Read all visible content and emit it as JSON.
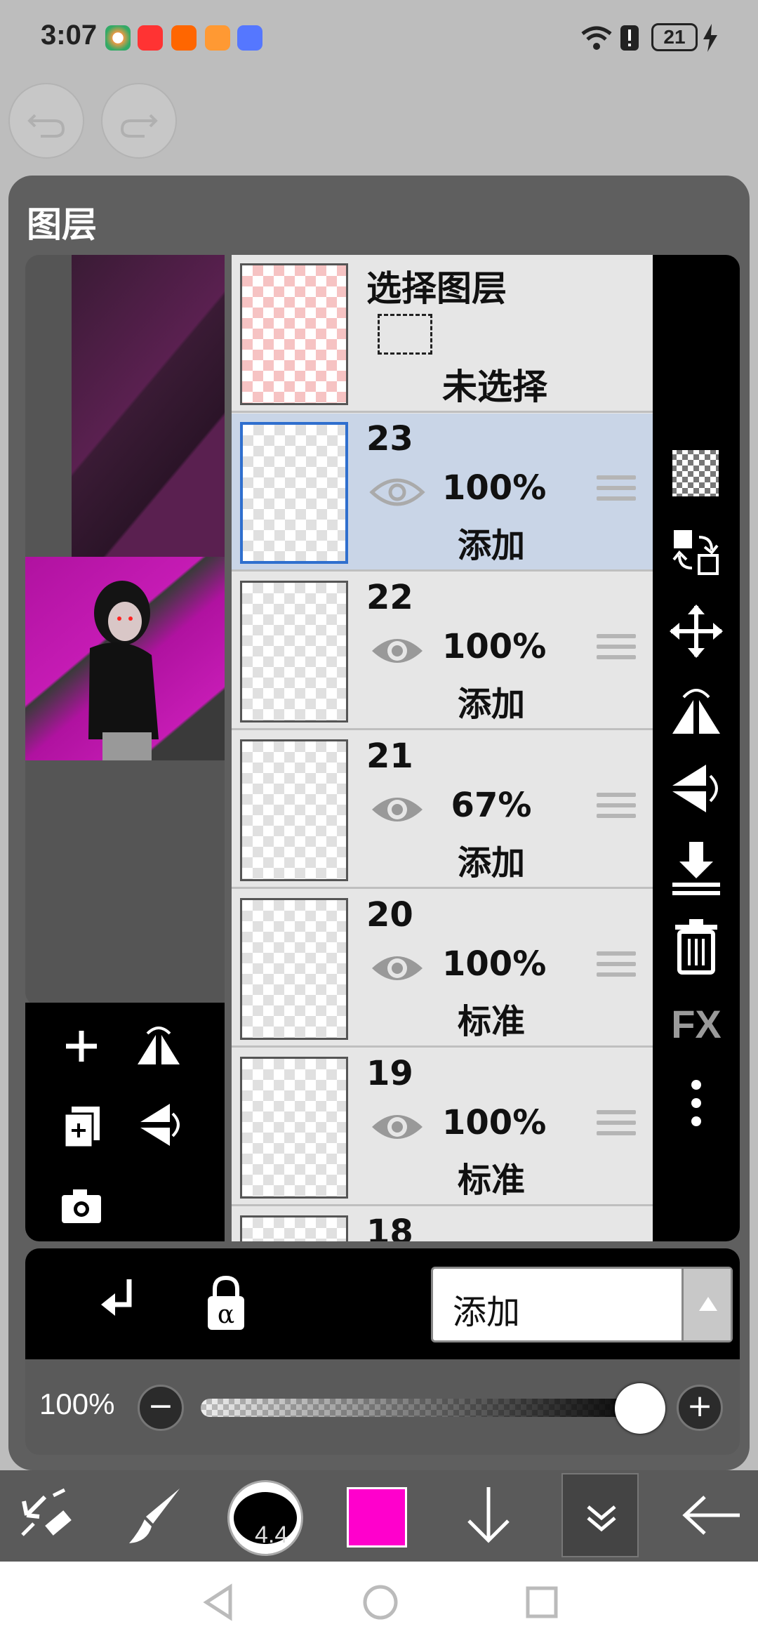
{
  "status_bar": {
    "time": "3:07",
    "battery": "21"
  },
  "panel": {
    "title": "图层"
  },
  "selection_layer": {
    "title": "选择图层",
    "status": "未选择"
  },
  "layers": [
    {
      "number": "23",
      "opacity": "100%",
      "blend": "添加",
      "selected": true
    },
    {
      "number": "22",
      "opacity": "100%",
      "blend": "添加",
      "selected": false
    },
    {
      "number": "21",
      "opacity": "67%",
      "blend": "添加",
      "selected": false
    },
    {
      "number": "20",
      "opacity": "100%",
      "blend": "标准",
      "selected": false
    },
    {
      "number": "19",
      "opacity": "100%",
      "blend": "标准",
      "selected": false
    },
    {
      "number": "18"
    }
  ],
  "sidebar": {
    "fx_label": "FX"
  },
  "blend_bar": {
    "blend_mode": "添加"
  },
  "opacity_bar": {
    "value_label": "100%",
    "level": 1.0
  },
  "toolbar": {
    "brush_size": "4.4",
    "current_color": "#ff00cc"
  }
}
